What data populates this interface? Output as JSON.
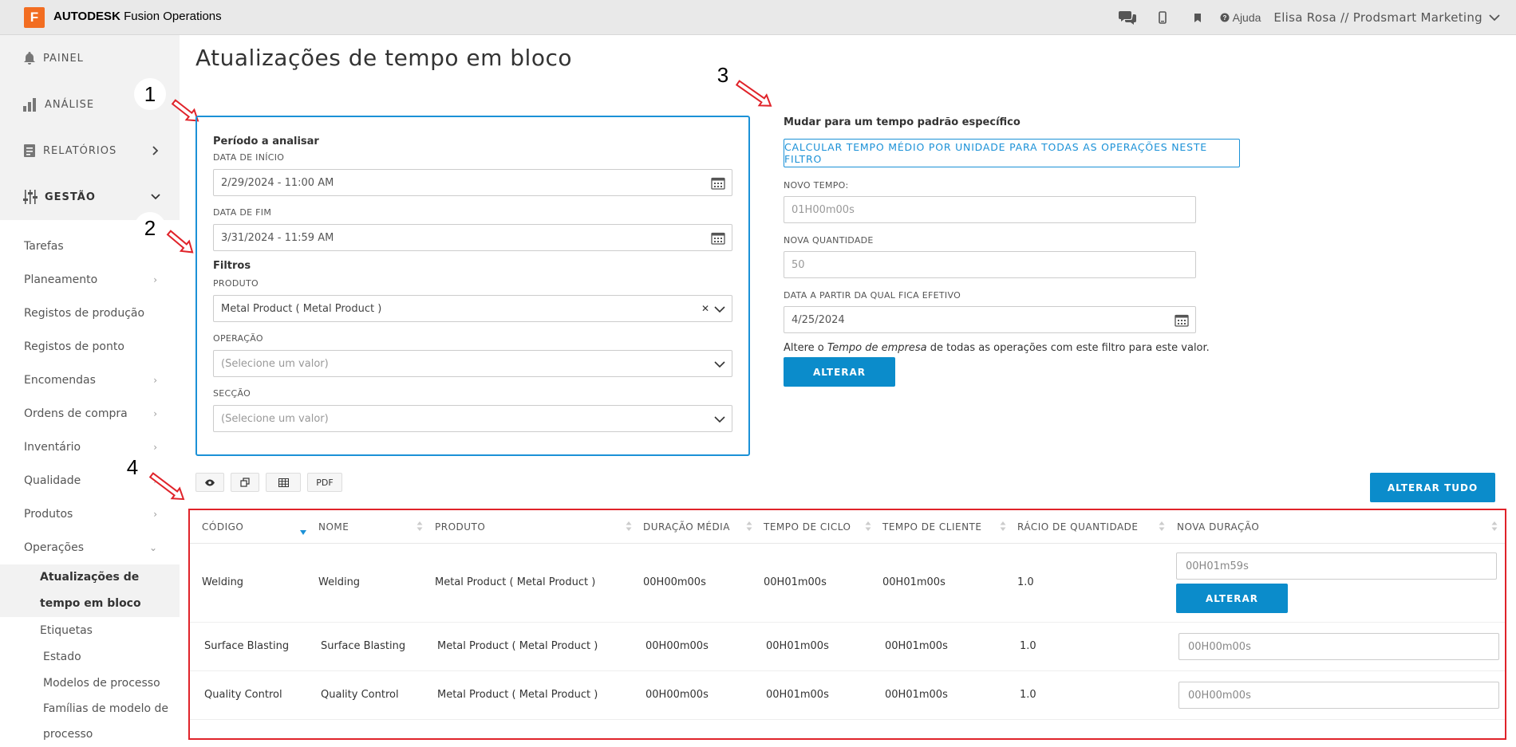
{
  "topbar": {
    "logo_letter": "F",
    "brand_bold": "AUTODESK",
    "brand_rest": " Fusion Operations",
    "help_label": "Ajuda",
    "user_label": "Elisa Rosa // Prodsmart Marketing",
    "icons": [
      "chat-icon",
      "mobile-icon",
      "bookmark-icon",
      "help-icon",
      "chevron-down-icon"
    ]
  },
  "sidebar": {
    "main": [
      {
        "label": "PAINEL",
        "icon": "bell-icon"
      },
      {
        "label": "ANÁLISE",
        "icon": "bar-chart-icon"
      },
      {
        "label": "RELATÓRIOS",
        "icon": "report-icon"
      },
      {
        "label": "GESTÃO",
        "icon": "sliders-icon"
      }
    ],
    "items": [
      {
        "label": "Tarefas"
      },
      {
        "label": "Planeamento"
      },
      {
        "label": "Registos de produção"
      },
      {
        "label": "Registos de ponto"
      },
      {
        "label": "Encomendas"
      },
      {
        "label": "Ordens de compra"
      },
      {
        "label": "Inventário"
      },
      {
        "label": "Qualidade"
      },
      {
        "label": "Produtos"
      },
      {
        "label": "Operações"
      }
    ],
    "sub": [
      {
        "label": "Atualizações de tempo em bloco"
      },
      {
        "label": "Etiquetas"
      },
      {
        "label": "Estado"
      },
      {
        "label": "Modelos de processo"
      },
      {
        "label": "Famílias de modelo de processo"
      }
    ]
  },
  "page": {
    "title": "Atualizações de tempo em bloco"
  },
  "badges": [
    "1",
    "2",
    "3",
    "4"
  ],
  "period": {
    "title": "Período a analisar",
    "start_label": "DATA DE INÍCIO",
    "start_value": "2/29/2024 - 11:00 AM",
    "end_label": "DATA DE FIM",
    "end_value": "3/31/2024 - 11:59 AM"
  },
  "filters": {
    "title": "Filtros",
    "product_label": "PRODUTO",
    "product_value": "Metal Product ( Metal Product )",
    "operation_label": "OPERAÇÃO",
    "operation_placeholder": "(Selecione um valor)",
    "section_label": "SECÇÃO",
    "section_placeholder": "(Selecione um valor)"
  },
  "change": {
    "title": "Mudar para um tempo padrão específico",
    "calc_button": "CALCULAR TEMPO MÉDIO POR UNIDADE PARA TODAS AS OPERAÇÕES NESTE FILTRO",
    "new_time_label": "NOVO TEMPO:",
    "new_time_value": "01H00m00s",
    "new_qty_label": "NOVA QUANTIDADE",
    "new_qty_value": "50",
    "effective_label": "DATA A PARTIR DA QUAL FICA EFETIVO",
    "effective_value": "4/25/2024",
    "note_pre": "Altere o ",
    "note_em": "Tempo de empresa",
    "note_post": " de todas as operações com este filtro para este valor.",
    "alter_button": "ALTERAR"
  },
  "toolbar": {
    "pdf_label": "PDF",
    "icons": [
      "eye-icon",
      "copy-icon",
      "table-icon"
    ]
  },
  "alter_all_button": "ALTERAR TUDO",
  "table": {
    "headers": [
      "CÓDIGO",
      "NOME",
      "PRODUTO",
      "DURAÇÃO MÉDIA",
      "TEMPO DE CICLO",
      "TEMPO DE CLIENTE",
      "RÁCIO DE QUANTIDADE",
      "NOVA DURAÇÃO"
    ],
    "rows": [
      {
        "code": "Welding",
        "name": "Welding",
        "product": "Metal Product ( Metal Product )",
        "avg": "00H00m00s",
        "cycle": "00H01m00s",
        "client": "00H01m00s",
        "ratio": "1.0",
        "new": "00H01m59s",
        "button": "ALTERAR"
      },
      {
        "code": "Surface Blasting",
        "name": "Surface Blasting",
        "product": "Metal Product ( Metal Product )",
        "avg": "00H00m00s",
        "cycle": "00H01m00s",
        "client": "00H01m00s",
        "ratio": "1.0",
        "new": "00H00m00s"
      },
      {
        "code": "Quality Control",
        "name": "Quality Control",
        "product": "Metal Product ( Metal Product )",
        "avg": "00H00m00s",
        "cycle": "00H01m00s",
        "client": "00H01m00s",
        "ratio": "1.0",
        "new": "00H00m00s"
      }
    ]
  },
  "colors": {
    "accent": "#0b8ccb",
    "card_border": "#1b91d7",
    "annotation": "#e0232a",
    "logo": "#f26d21"
  }
}
